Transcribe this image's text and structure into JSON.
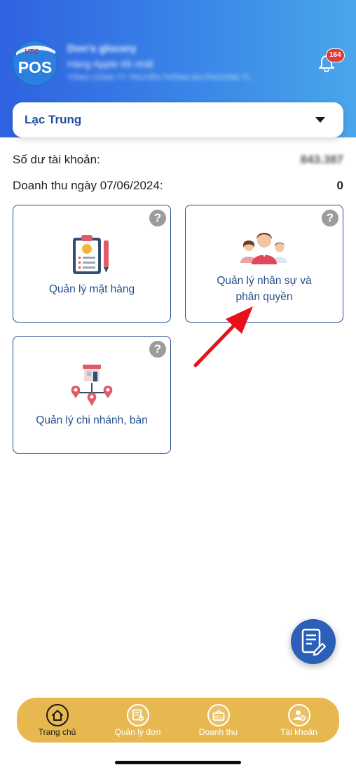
{
  "header": {
    "logo_text": "POS",
    "logo_brand": "VTC",
    "shop_name": "Don’s glocery",
    "shop_subtitle": "Hàng Apple tốt nhất",
    "shop_org": "TỔNG CÔNG TY TRUYỀN THÔNG ĐA PHƯƠNG TI...",
    "notification_count": "164"
  },
  "branch": {
    "selected": "Lạc Trung"
  },
  "stats": {
    "balance_label": "Số dư tài khoản:",
    "balance_value": "843.387",
    "revenue_label": "Doanh thu ngày 07/06/2024:",
    "revenue_value": "0"
  },
  "cards": {
    "help_glyph": "?",
    "products": "Quản lý mặt hàng",
    "staff_line1": "Quản lý nhân sự và",
    "staff_line2": "phân quyền",
    "branches": "Quản lý chi nhánh, bàn"
  },
  "nav": {
    "home": "Trang chủ",
    "orders": "Quản lý đơn",
    "revenue": "Doanh thu",
    "account": "Tài khoản"
  },
  "colors": {
    "header_start": "#2f62e0",
    "header_end": "#4aa6ea",
    "accent_blue": "#234e93",
    "nav_background": "#e8b850",
    "badge_red": "#e53935",
    "arrow_red": "#e8111b"
  }
}
